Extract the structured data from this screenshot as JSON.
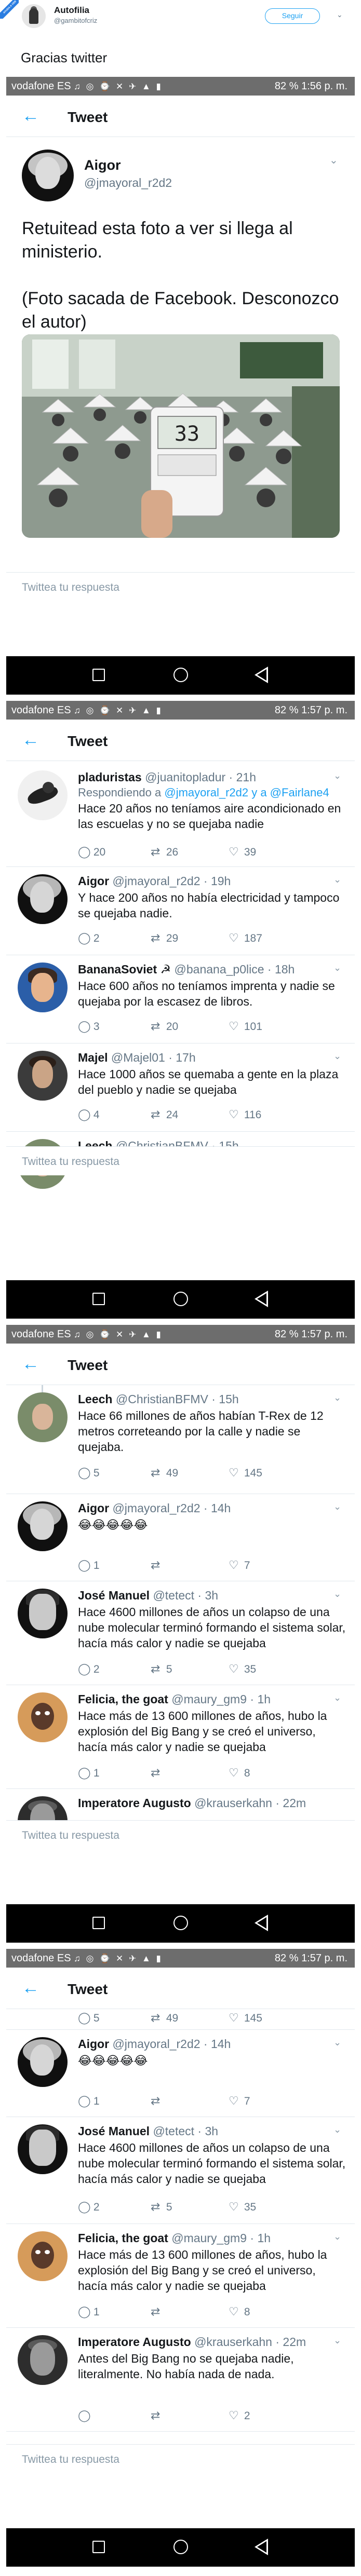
{
  "outer": {
    "badge": "AYUDA A VER",
    "name": "Autofilia",
    "handle": "@gambitofcriz",
    "follow_label": "Seguir",
    "text": "Gracias twitter"
  },
  "status_bar": {
    "carrier": "vodafone ES",
    "icons": "♫ ◎ ⌚ ✕ ✈ ▲ ▮",
    "battery": "82 %",
    "time_1": "1:56 p. m.",
    "time_2": "1:57 p. m."
  },
  "nav": {
    "back": "←",
    "title": "Tweet"
  },
  "reply_placeholder": "Twittea tu respuesta",
  "main_tweet": {
    "name": "Aigor",
    "handle": "@jmayoral_r2d2",
    "text": "Retuitead esta foto a ver si llega al ministerio.\n\n(Foto sacada de Facebook. Desconozco el autor)",
    "thermometer": "33"
  },
  "replies": {
    "pladuristas": {
      "name": "pladuristas",
      "handle": "@juanitopladur · 21h",
      "replying_prefix": "Respondiendo a",
      "replying_links": "@jmayoral_r2d2 y a @Fairlane4",
      "text": "Hace 20 años no teníamos aire acondicionado en las escuelas y no se quejaba nadie",
      "replies": "20",
      "retweets": "26",
      "likes": "39"
    },
    "aigor_1": {
      "name": "Aigor",
      "handle": "@jmayoral_r2d2 · 19h",
      "text": "Y hace 200 años no había electricidad y tampoco se quejaba nadie.",
      "replies": "2",
      "retweets": "29",
      "likes": "187"
    },
    "banana": {
      "name": "BananaSoviet ☭",
      "handle": "@banana_p0lice · 18h",
      "text": "Hace 600 años no teníamos imprenta y nadie se quejaba por la escasez de libros.",
      "replies": "3",
      "retweets": "20",
      "likes": "101"
    },
    "majel": {
      "name": "Majel",
      "handle": "@Majel01 · 17h",
      "text": "Hace 1000 años se quemaba a gente en la plaza del pueblo y nadie se quejaba",
      "replies": "4",
      "retweets": "24",
      "likes": "116"
    },
    "leech": {
      "name": "Leech",
      "handle": "@ChristianBFMV · 15h",
      "text": "Hace 66 millones de años habían T-Rex de 12 metros correteando por la calle y nadie se quejaba.",
      "replies": "5",
      "retweets": "49",
      "likes": "145"
    },
    "aigor_2": {
      "name": "Aigor",
      "handle": "@jmayoral_r2d2 · 14h",
      "text": "😂😂😂😂😂",
      "replies": "1",
      "retweets": "",
      "likes": "7"
    },
    "jose": {
      "name": "José Manuel",
      "handle": "@tetect · 3h",
      "text": "Hace 4600 millones de años un colapso de una nube molecular terminó formando el sistema solar, hacía más calor y nadie se quejaba",
      "replies": "2",
      "retweets": "5",
      "likes": "35"
    },
    "felicia": {
      "name": "Felicia, the goat",
      "handle": "@maury_gm9 · 1h",
      "text": "Hace más de 13 600 millones de años, hubo la explosión del Big Bang y se creó el universo, hacía más calor y nadie se quejaba",
      "replies": "1",
      "retweets": "",
      "likes": "8"
    },
    "augusto": {
      "name": "Imperatore Augusto",
      "handle": "@krauserkahn · 22m",
      "text": "Antes del Big Bang no se quejaba nadie, literalmente. No había nada de nada.",
      "replies": "",
      "retweets": "",
      "likes": "2"
    }
  }
}
